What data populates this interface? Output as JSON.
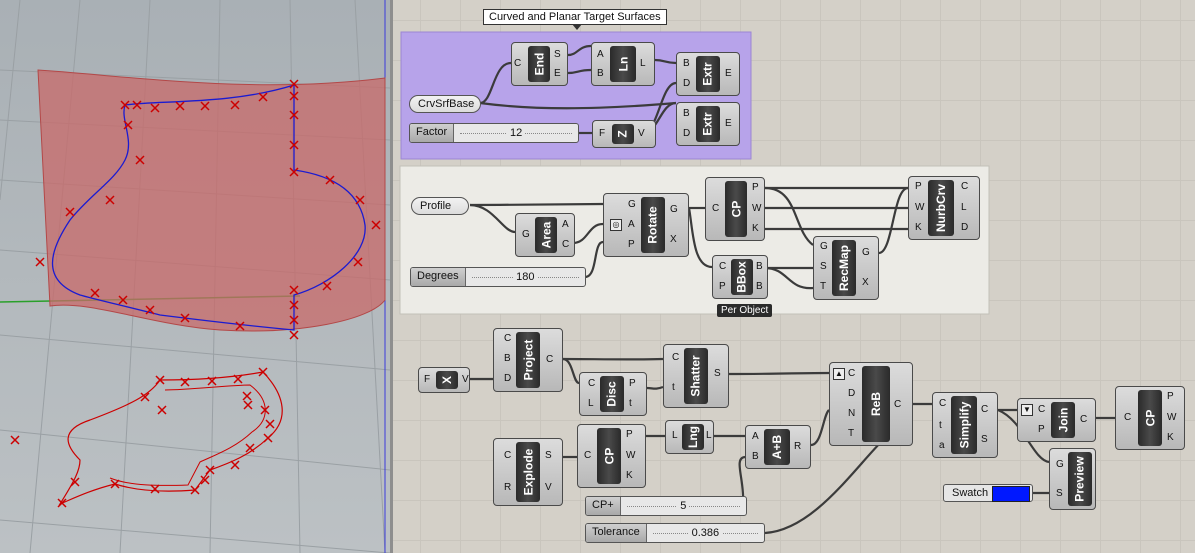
{
  "viewport": {
    "point_marker": "x-icon",
    "curve_color": "#cc0000",
    "surface_color": "#c86a6a"
  },
  "canvas": {
    "tooltip": "Curved and Planar Target Surfaces",
    "colors": {
      "group1": "#b7a3ea",
      "group2": "#ecebe6",
      "swatch": "#0018ff"
    },
    "components": {
      "end": {
        "nick": "End",
        "inputs": [
          "C"
        ],
        "outputs": [
          "S",
          "E"
        ]
      },
      "ln": {
        "nick": "Ln",
        "inputs": [
          "A",
          "B"
        ],
        "outputs": [
          "L"
        ]
      },
      "extr1": {
        "nick": "Extr",
        "inputs": [
          "B",
          "D"
        ],
        "outputs": [
          "E"
        ]
      },
      "extr2": {
        "nick": "Extr",
        "inputs": [
          "B",
          "D"
        ],
        "outputs": [
          "E"
        ]
      },
      "z": {
        "nick": "Z",
        "inputs": [
          "F"
        ],
        "outputs": [
          "V"
        ]
      },
      "area": {
        "nick": "Area",
        "inputs": [
          "G"
        ],
        "outputs": [
          "A",
          "C"
        ]
      },
      "rotate": {
        "nick": "Rotate",
        "inputs": [
          "G",
          "A",
          "P"
        ],
        "outputs": [
          "G",
          "X"
        ]
      },
      "cp1": {
        "nick": "CP",
        "inputs": [
          "C"
        ],
        "outputs": [
          "P",
          "W",
          "K"
        ]
      },
      "bbox": {
        "nick": "BBox",
        "inputs": [
          "C",
          "P"
        ],
        "outputs": [
          "B",
          "B"
        ],
        "label": "Per Object"
      },
      "recmap": {
        "nick": "RecMap",
        "inputs": [
          "G",
          "S",
          "T"
        ],
        "outputs": [
          "G",
          "X"
        ]
      },
      "nurb": {
        "nick": "NurbCrv",
        "inputs": [
          "P",
          "W",
          "K"
        ],
        "outputs": [
          "C",
          "L",
          "D"
        ]
      },
      "x": {
        "nick": "X",
        "inputs": [
          "F"
        ],
        "outputs": [
          "V"
        ]
      },
      "project": {
        "nick": "Project",
        "inputs": [
          "C",
          "B",
          "D"
        ],
        "outputs": [
          "C"
        ]
      },
      "disc": {
        "nick": "Disc",
        "inputs": [
          "C",
          "L"
        ],
        "outputs": [
          "P",
          "t"
        ]
      },
      "shatter": {
        "nick": "Shatter",
        "inputs": [
          "C",
          "t"
        ],
        "outputs": [
          "S"
        ]
      },
      "explode": {
        "nick": "Explode",
        "inputs": [
          "C",
          "R"
        ],
        "outputs": [
          "S",
          "V"
        ]
      },
      "cp2": {
        "nick": "CP",
        "inputs": [
          "C"
        ],
        "outputs": [
          "P",
          "W",
          "K"
        ]
      },
      "lng": {
        "nick": "Lng",
        "inputs": [
          "L"
        ],
        "outputs": [
          "L"
        ]
      },
      "apb": {
        "nick": "A+B",
        "inputs": [
          "A",
          "B"
        ],
        "outputs": [
          "R"
        ]
      },
      "reb": {
        "nick": "ReB",
        "inputs": [
          "C",
          "D",
          "N",
          "T"
        ],
        "outputs": [
          "C"
        ]
      },
      "simplify": {
        "nick": "Simplify",
        "inputs": [
          "C",
          "t",
          "a"
        ],
        "outputs": [
          "C",
          "S"
        ]
      },
      "join": {
        "nick": "Join",
        "inputs": [
          "C",
          "P"
        ],
        "outputs": [
          "C"
        ]
      },
      "cp3": {
        "nick": "CP",
        "inputs": [
          "C"
        ],
        "outputs": [
          "P",
          "W",
          "K"
        ]
      },
      "preview": {
        "nick": "Preview",
        "inputs": [
          "G",
          "S"
        ],
        "outputs": []
      }
    },
    "params": {
      "crvsrfbase": "CrvSrfBase",
      "profile": "Profile",
      "swatch": "Swatch"
    },
    "sliders": {
      "factor": {
        "label": "Factor",
        "value": "12"
      },
      "degrees": {
        "label": "Degrees",
        "value": "180"
      },
      "cpplus": {
        "label": "CP+",
        "value": "5"
      },
      "tolerance": {
        "label": "Tolerance",
        "value": "0.386"
      }
    }
  }
}
